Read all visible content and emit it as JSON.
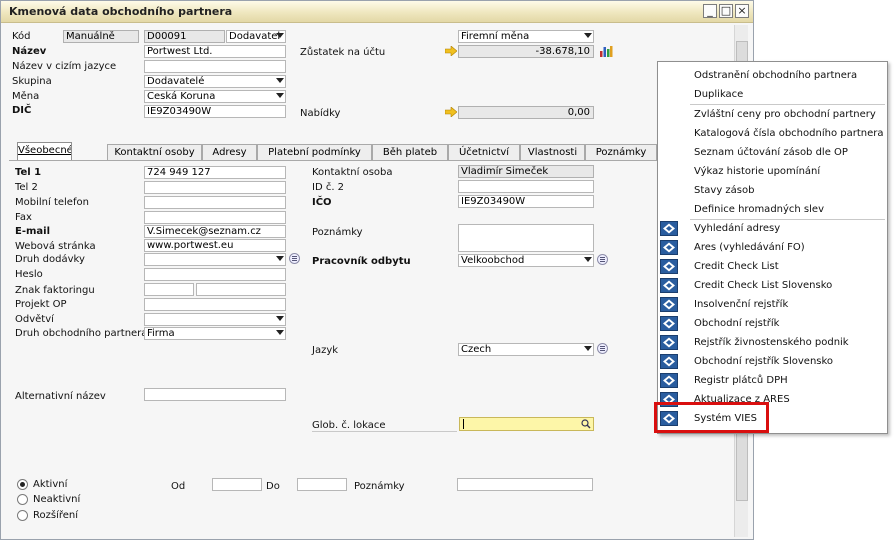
{
  "window": {
    "title": "Kmenová data obchodního partnera",
    "controls": {
      "minimize": "_",
      "restore": "□",
      "close": "×"
    }
  },
  "header": {
    "kod_label": "Kód",
    "numbering_series": "Manuálně",
    "code_value": "D00091",
    "partner_type": "Dodavatel",
    "nazev_label": "Název",
    "nazev_value": "Portwest Ltd.",
    "foreign_name_label": "Název v cizím jazyce",
    "foreign_name_value": "",
    "skupina_label": "Skupina",
    "skupina_value": "Dodavatelé",
    "mena_label": "Měna",
    "mena_value": "Česká Koruna",
    "dic_label": "DIČ",
    "dic_value": "IE9Z03490W",
    "currency_select": "Firemní měna",
    "balance_label": "Zůstatek na účtu",
    "balance_value": "-38.678,10",
    "offers_label": "Nabídky",
    "offers_value": "0,00"
  },
  "tabs": [
    {
      "label": "Všeobecné"
    },
    {
      "label": "Kontaktní osoby"
    },
    {
      "label": "Adresy"
    },
    {
      "label": "Platební podmínky"
    },
    {
      "label": "Běh plateb"
    },
    {
      "label": "Účetnictví"
    },
    {
      "label": "Vlastnosti"
    },
    {
      "label": "Poznámky"
    }
  ],
  "general": {
    "tel1_label": "Tel 1",
    "tel1_value": "724 949 127",
    "tel2_label": "Tel 2",
    "tel2_value": "",
    "mobile_label": "Mobilní telefon",
    "fax_label": "Fax",
    "email_label": "E-mail",
    "email_value": "V.Simecek@seznam.cz",
    "web_label": "Webová stránka",
    "web_value": "www.portwest.eu",
    "shipping_label": "Druh dodávky",
    "password_label": "Heslo",
    "factoring_label": "Znak faktoringu",
    "project_label": "Projekt OP",
    "industry_label": "Odvětví",
    "partner_kind_label": "Druh obchodního partnera",
    "partner_kind_value": "Firma",
    "alt_name_label": "Alternativní název",
    "contact_person_label": "Kontaktní osoba",
    "contact_person_value": "Vladimír Šimeček",
    "id2_label": "ID č. 2",
    "ico_label": "IČO",
    "ico_value": "IE9Z03490W",
    "notes_label": "Poznámky",
    "employee_label": "Pracovník odbytu",
    "employee_value": "Velkoobchod",
    "language_label": "Jazyk",
    "language_value": "Czech",
    "glob_label": "Glob. č. lokace"
  },
  "status": {
    "active_label": "Aktivní",
    "inactive_label": "Neaktivní",
    "extended_label": "Rozšíření",
    "from_label": "Od",
    "to_label": "Do",
    "notes_label": "Poznámky"
  },
  "context_menu": {
    "items": [
      {
        "label": "Odstranění obchodního partnera",
        "icon": "none"
      },
      {
        "label": "Duplikace",
        "icon": "none"
      },
      {
        "label": "Zvláštní ceny pro obchodní partnery",
        "icon": "none"
      },
      {
        "label": "Katalogová čísla obchodního partnera",
        "icon": "none"
      },
      {
        "label": "Seznam účtování zásob dle OP",
        "icon": "none"
      },
      {
        "label": "Výkaz historie upomínání",
        "icon": "none"
      },
      {
        "label": "Stavy zásob",
        "icon": "none"
      },
      {
        "label": "Definice hromadných slev",
        "icon": "none"
      },
      {
        "label": "Vyhledání adresy",
        "icon": "addon-icon"
      },
      {
        "label": "Ares (vyhledávání FO)",
        "icon": "addon-icon"
      },
      {
        "label": "Credit Check List",
        "icon": "addon-icon"
      },
      {
        "label": "Credit Check List Slovensko",
        "icon": "addon-icon"
      },
      {
        "label": "Insolvenční rejstřík",
        "icon": "addon-icon"
      },
      {
        "label": "Obchodní rejstřík",
        "icon": "addon-icon"
      },
      {
        "label": "Rejstřík živnostenského podnik",
        "icon": "addon-icon"
      },
      {
        "label": "Obchodní rejstřík Slovensko",
        "icon": "addon-icon"
      },
      {
        "label": "Registr plátců DPH",
        "icon": "addon-icon"
      },
      {
        "label": "Aktualizace z ARES",
        "icon": "addon-icon"
      },
      {
        "label": "Systém VIES",
        "icon": "addon-icon"
      }
    ]
  },
  "colors": {
    "highlight_border": "#d90f0f",
    "title_bar": "#efe7bf",
    "link_arrow": "#f0c020",
    "yellow_field": "#fdf6a8"
  }
}
